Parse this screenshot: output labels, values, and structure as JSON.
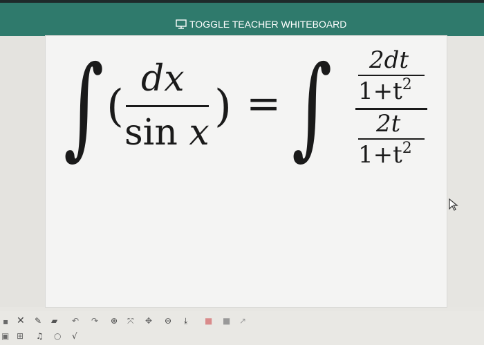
{
  "header": {
    "toggle_label": "TOGGLE TEACHER WHITEBOARD",
    "toggle_icon": "whiteboard-icon"
  },
  "whiteboard": {
    "lhs": {
      "integral_sign": "∫",
      "open_paren": "(",
      "numerator": "dx",
      "denominator_fn": "sin",
      "denominator_var": "x",
      "close_paren": ")"
    },
    "equals": "=",
    "rhs": {
      "integral_sign": "∫",
      "top_numerator": "2dt",
      "top_denominator": "1+t",
      "top_denominator_exp": "2",
      "bottom_numerator": "2t",
      "bottom_denominator": "1+t",
      "bottom_denominator_exp": "2"
    }
  },
  "toolbar": {
    "row1_icons": [
      "square-icon",
      "close-icon",
      "pen-icon",
      "eraser-icon",
      "undo-icon",
      "redo-icon",
      "zoom-in-icon",
      "fit-icon",
      "move-icon",
      "zoom-out-icon",
      "download-icon",
      "delete-icon",
      "color-icon",
      "more-icon"
    ],
    "row2_icons": [
      "screen-icon",
      "grid-icon",
      "music-icon",
      "circle-icon",
      "sqrt-icon"
    ]
  },
  "colors": {
    "header_bg": "#2f7a6c",
    "board_bg": "#f4f4f3",
    "ink": "#1a1a1a"
  }
}
